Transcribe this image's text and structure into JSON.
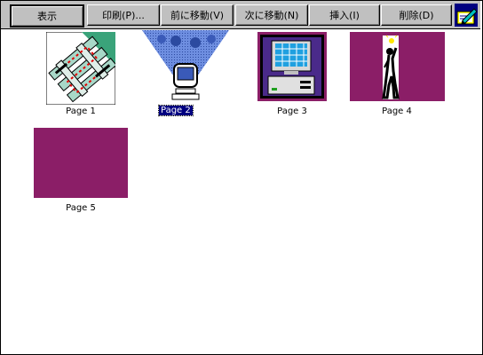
{
  "toolbar": {
    "buttons": [
      {
        "label": "表示"
      },
      {
        "label": "印刷(P)..."
      },
      {
        "label": "前に移動(V)"
      },
      {
        "label": "次に移動(N)"
      },
      {
        "label": "挿入(I)"
      },
      {
        "label": "削除(D)"
      }
    ],
    "app_icon": "pencil-paper-icon"
  },
  "pages": [
    {
      "label": "Page 1",
      "thumbnail": "network-map-icon",
      "selected": false
    },
    {
      "label": "Page 2",
      "thumbnail": "computer-spotlight-icon",
      "selected": true
    },
    {
      "label": "Page 3",
      "thumbnail": "desktop-computer-icon",
      "selected": false
    },
    {
      "label": "Page 4",
      "thumbnail": "person-lightbulb-icon",
      "selected": false
    },
    {
      "label": "Page 5",
      "thumbnail": "blank-slide",
      "selected": false
    }
  ],
  "colors": {
    "toolbar": "#c0c0c0",
    "slide_purple": "#8b1e67",
    "selection": "#000080",
    "teal": "#3aa37a",
    "spot_blue": "#4a6fc9"
  }
}
